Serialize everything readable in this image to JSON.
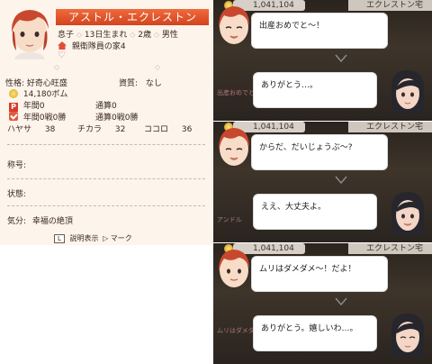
{
  "status": {
    "name": "アストル・エクレストン",
    "relation": "息子",
    "birth": "13日生まれ",
    "age": "2歳",
    "sex": "男性",
    "house": "親衛隊員の家4",
    "personality_label": "性格:",
    "personality": "好奇心旺盛",
    "talent_label": "資質:",
    "talent": "なし",
    "money": "14,180ボム",
    "annual_label": "年間0",
    "total_label": "通算0",
    "record_annual": "年間0戦0勝",
    "record_total": "通算0戦0勝",
    "stats": [
      {
        "label": "ハヤサ",
        "value": "38"
      },
      {
        "label": "チカラ",
        "value": "32"
      },
      {
        "label": "ココロ",
        "value": "36"
      }
    ],
    "title_label": "称号:",
    "condition_label": "状態:",
    "mood_label": "気分:",
    "mood": "幸福の絶頂",
    "footer_key": "L",
    "footer_text": "説明表示",
    "footer_mark": "マーク"
  },
  "scenes": [
    {
      "money": "1,041,104",
      "house": "エクレストン宅",
      "boy_line": "出産おめでと～！",
      "woman_line": "ありがとう…。",
      "ghost": "出産おめでと アンドル"
    },
    {
      "money": "1,041,104",
      "house": "エクレストン宅",
      "boy_line": "からだ、だいじょうぶ～?",
      "woman_line": "ええ、大丈夫よ。",
      "ghost": "アンドル"
    },
    {
      "money": "1,041,104",
      "house": "エクレストン宅",
      "boy_line": "ムリはダメダメ～！だよ！",
      "woman_line": "ありがとう。嬉しいわ…。",
      "ghost": "ムリはダメダメ アンドル"
    }
  ],
  "colors": {
    "banner": "#e0552c",
    "panel_bg": "#fdf4ec",
    "scene_bg": "#2e2822"
  }
}
